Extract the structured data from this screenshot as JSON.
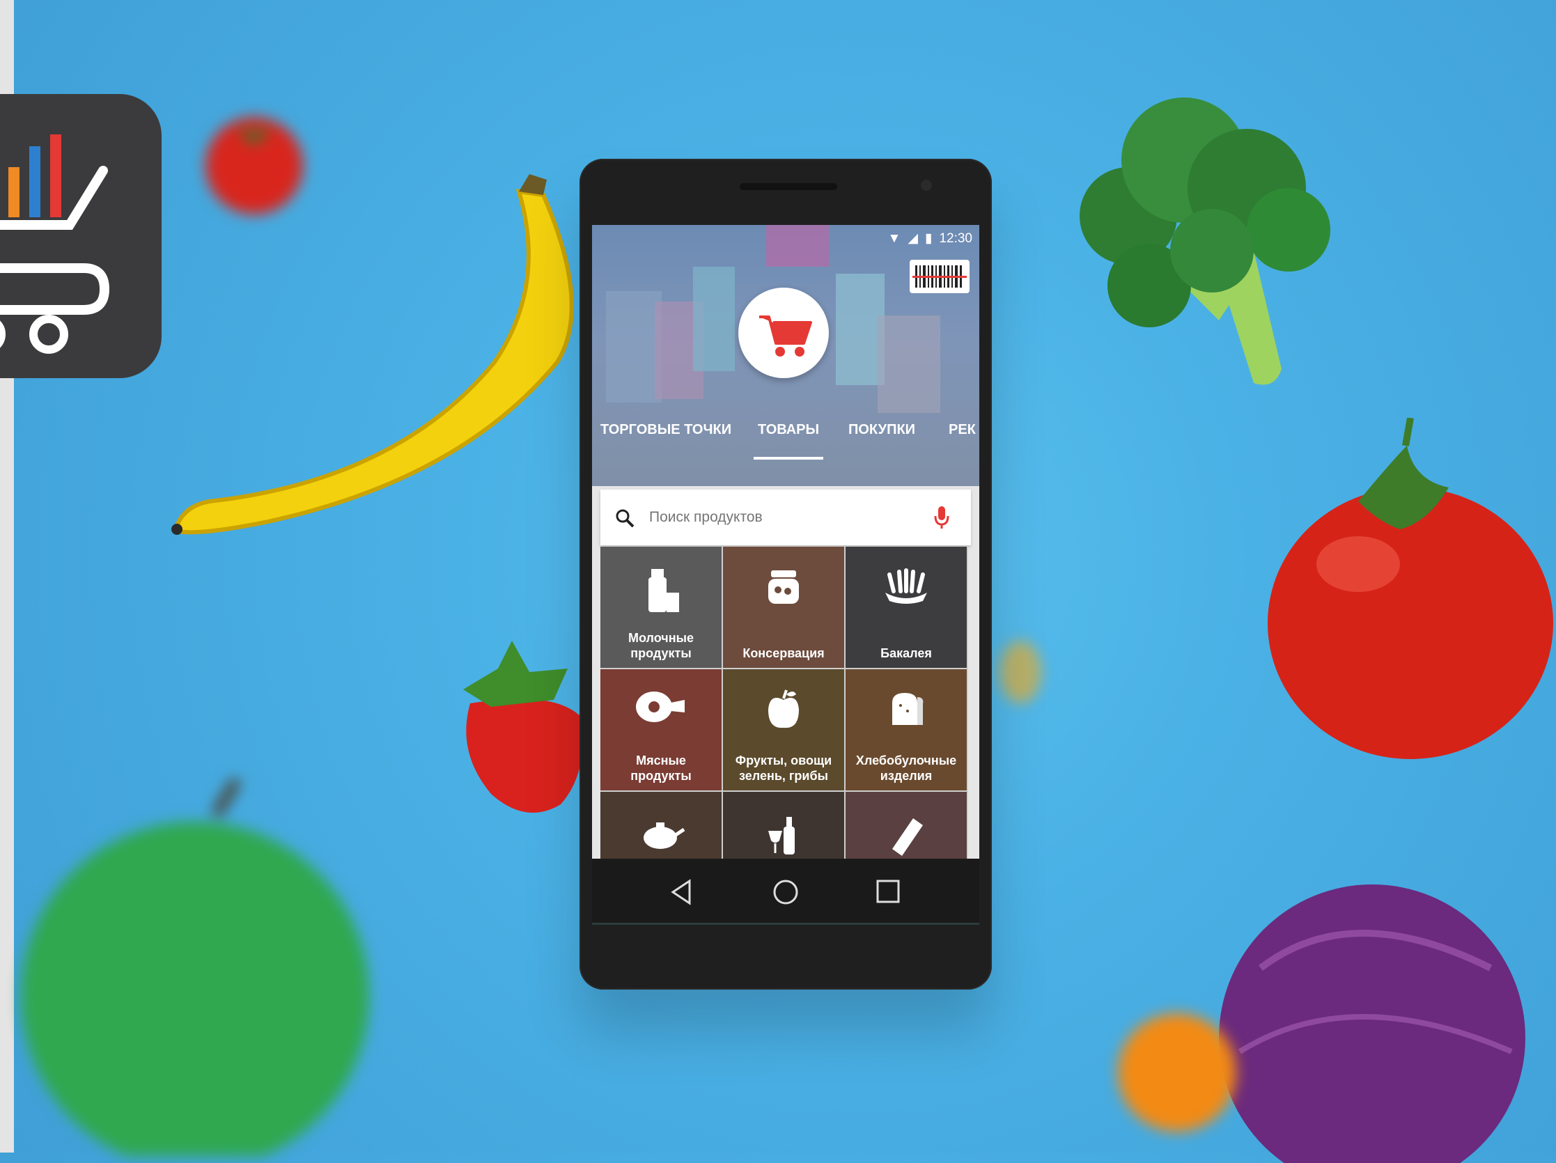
{
  "status_bar": {
    "time": "12:30"
  },
  "tabs": [
    {
      "label": "ТОРГОВЫЕ ТОЧКИ"
    },
    {
      "label": "ТОВАРЫ"
    },
    {
      "label": "ПОКУПКИ"
    },
    {
      "label": "РЕК"
    }
  ],
  "search": {
    "placeholder": "Поиск продуктов"
  },
  "categories": [
    {
      "label": "Молочные\nпродукты"
    },
    {
      "label": "Консервация"
    },
    {
      "label": "Бакалея"
    },
    {
      "label": "Мясные\nпродукты"
    },
    {
      "label": "Фрукты, овощи\nзелень, грибы"
    },
    {
      "label": "Хлебобулочные\nизделия"
    }
  ],
  "colors": {
    "background": "#4bb2e6",
    "accent_red": "#e53935",
    "app_icon_bg": "#3b3b3d"
  }
}
